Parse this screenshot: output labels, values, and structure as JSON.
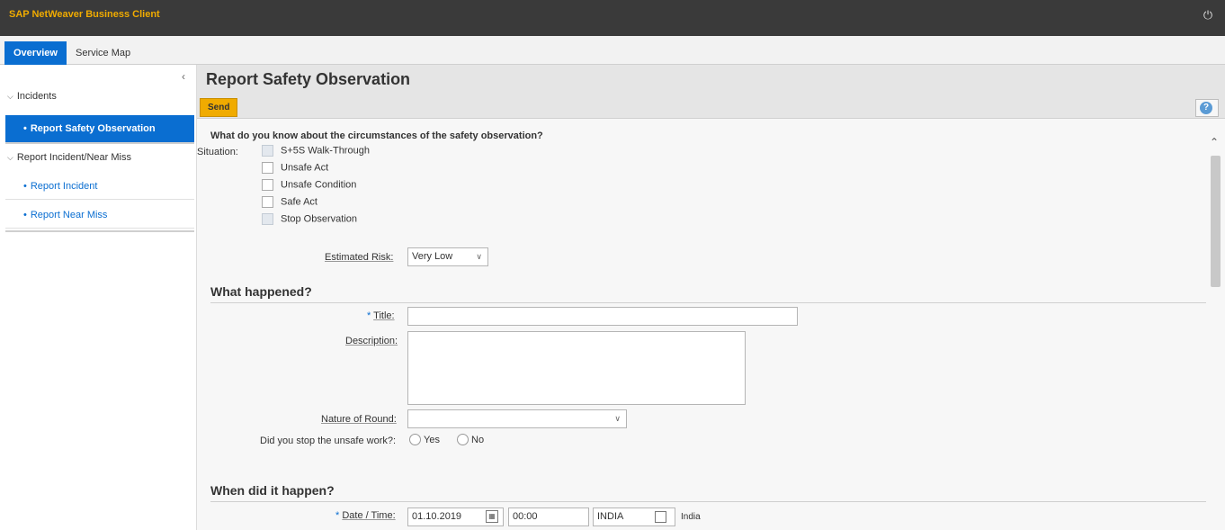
{
  "app": {
    "title": "SAP NetWeaver Business Client"
  },
  "tabs": [
    {
      "label": "Overview"
    },
    {
      "label": "Service Map"
    }
  ],
  "sidebar": {
    "groups": [
      {
        "label": "Incidents",
        "items": [
          {
            "label": "Report Safety Observation",
            "selected": true
          }
        ]
      },
      {
        "label": "Report Incident/Near Miss",
        "items": [
          {
            "label": "Report Incident"
          },
          {
            "label": "Report Near Miss"
          }
        ]
      }
    ]
  },
  "page": {
    "title": "Report Safety Observation",
    "send_label": "Send",
    "help_label": "?"
  },
  "form": {
    "question": "What do you know about the circumstances of the safety observation?",
    "situation_label": "Situation:",
    "situations": [
      {
        "label": "S+5S Walk-Through",
        "disabled": true
      },
      {
        "label": "Unsafe Act"
      },
      {
        "label": "Unsafe Condition"
      },
      {
        "label": "Safe Act"
      },
      {
        "label": "Stop Observation",
        "disabled": true
      }
    ],
    "risk_label": "Estimated Risk:",
    "risk_value": "Very Low",
    "section_what": "What happened?",
    "title_label": "Title:",
    "title_required": "*",
    "title_value": "",
    "description_label": "Description:",
    "nature_label": "Nature of Round:",
    "nature_value": "",
    "stop_label": "Did you stop the unsafe work?:",
    "stop_options": [
      "Yes",
      "No"
    ],
    "section_when": "When did it happen?",
    "datetime_label": "Date / Time:",
    "datetime_required": "*",
    "date_value": "01.10.2019",
    "time_value": "00:00",
    "timezone_value": "INDIA",
    "timezone_text": "India"
  }
}
